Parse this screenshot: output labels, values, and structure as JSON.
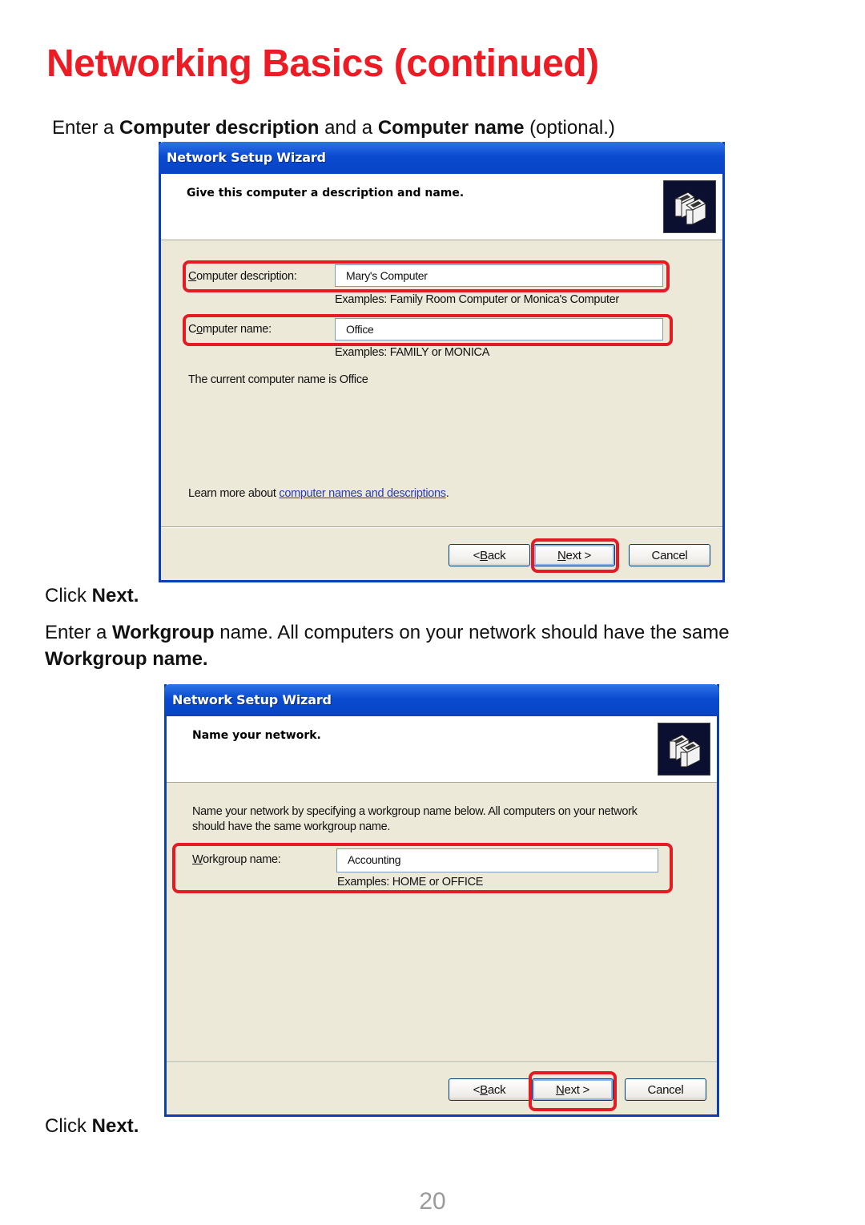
{
  "page": {
    "title": "Networking Basics (continued)",
    "intro_1": {
      "prefix": "Enter a ",
      "bold1": "Computer description",
      "middle": " and a ",
      "bold2": "Computer name",
      "suffix": " (optional.)"
    },
    "click_next_1": {
      "prefix": "Click ",
      "bold": "Next."
    },
    "intro_2": {
      "prefix": "Enter a ",
      "bold1": "Workgroup",
      "suffix": " name. All computers on your network should have the same",
      "line2_bold": "Workgroup name."
    },
    "click_next_2": {
      "prefix": "Click ",
      "bold": "Next."
    },
    "page_number": "20"
  },
  "wizard1": {
    "title": "Network Setup Wizard",
    "heading": "Give this computer a description and name.",
    "icon": "network-computers-icon",
    "description_label_mnemonic": "C",
    "description_label_rest": "omputer description:",
    "description_value": "Mary's Computer",
    "description_examples": "Examples: Family Room Computer or Monica's Computer",
    "name_label_first": "C",
    "name_label_mnemonic": "o",
    "name_label_rest": "mputer name:",
    "name_value": "Office",
    "name_examples": "Examples: FAMILY or MONICA",
    "current_name_text": "The current computer name is Office",
    "learn_more_prefix": "Learn more about ",
    "learn_more_link": "computer names and descriptions",
    "learn_more_suffix": ".",
    "buttons": {
      "back_prefix": "< ",
      "back_mnemonic": "B",
      "back_rest": "ack",
      "next_mnemonic": "N",
      "next_rest": "ext >",
      "cancel": "Cancel"
    }
  },
  "wizard2": {
    "title": "Network Setup Wizard",
    "heading": "Name your network.",
    "icon": "network-computers-icon",
    "instructions_line1": "Name your network by specifying a workgroup name below. All computers on your network",
    "instructions_line2": "should have the same workgroup name.",
    "workgroup_label_mnemonic": "W",
    "workgroup_label_rest": "orkgroup name:",
    "workgroup_value": "Accounting",
    "workgroup_examples": "Examples: HOME or OFFICE",
    "buttons": {
      "back_prefix": "< ",
      "back_mnemonic": "B",
      "back_rest": "ack",
      "next_mnemonic": "N",
      "next_rest": "ext >",
      "cancel": "Cancel"
    }
  },
  "colors": {
    "title_red": "#ed1c24",
    "highlight_red": "#e51b24",
    "xp_blue": "#0a4bd0",
    "dialog_bg": "#ece9d8"
  }
}
